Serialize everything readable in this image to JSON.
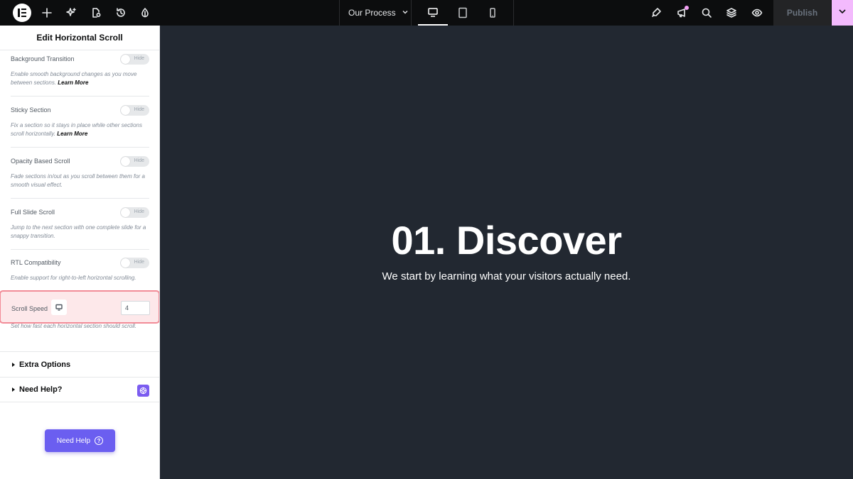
{
  "topbar": {
    "page_name": "Our Process",
    "publish_label": "Publish",
    "devices": [
      "desktop",
      "tablet",
      "mobile"
    ],
    "active_device": "desktop",
    "colors": {
      "bar": "#0c0d0e",
      "publish_accent": "#f3bafd",
      "notify_dot": "#f39ff4"
    }
  },
  "panel": {
    "title": "Edit Horizontal Scroll",
    "toggle_off_text": "Hide",
    "controls": [
      {
        "label": "Background Transition",
        "desc": "Enable smooth background changes as you move between sections.",
        "link": "Learn More",
        "enabled": false
      },
      {
        "label": "Sticky Section",
        "desc": "Fix a section so it stays in place while other sections scroll horizontally.",
        "link": "Learn More",
        "enabled": false
      },
      {
        "label": "Opacity Based Scroll",
        "desc": "Fade sections in/out as you scroll between them for a smooth visual effect.",
        "link": "",
        "enabled": false
      },
      {
        "label": "Full Slide Scroll",
        "desc": "Jump to the next section with one complete slide for a snappy transition.",
        "link": "",
        "enabled": false
      },
      {
        "label": "RTL Compatibility",
        "desc": "Enable support for right-to-left horizontal scrolling.",
        "link": "",
        "enabled": false
      }
    ],
    "scroll_speed": {
      "label": "Scroll Speed",
      "value": "4",
      "desc": "Set how fast each horizontal section should scroll.",
      "highlight_color": "#f28b97"
    },
    "sections": [
      {
        "label": "Extra Options"
      },
      {
        "label": "Need Help?"
      }
    ],
    "help_button_label": "Need Help"
  },
  "canvas": {
    "title": "01. Discover",
    "subtitle": "We start by learning what your visitors actually need.",
    "background": "#222831"
  }
}
